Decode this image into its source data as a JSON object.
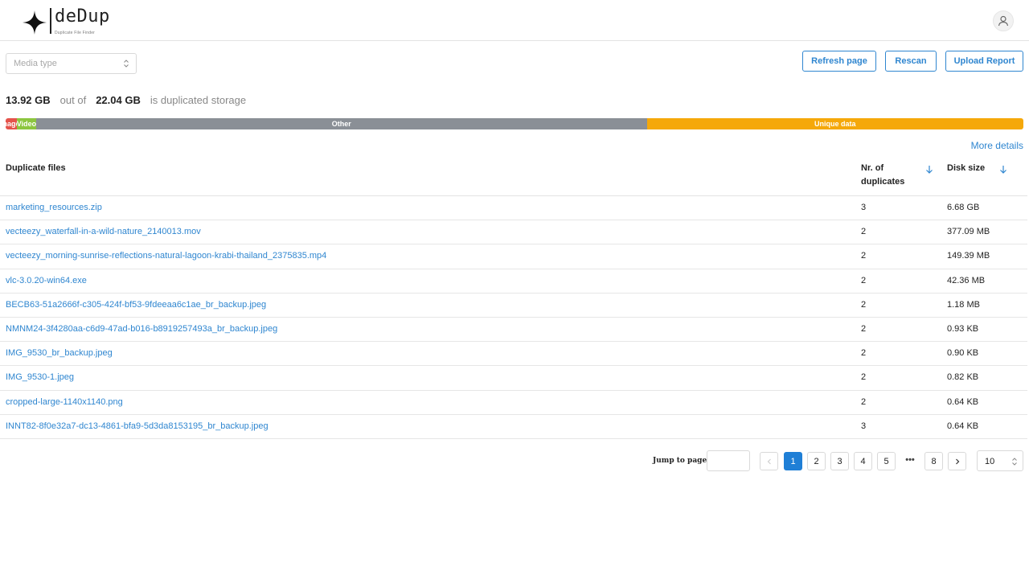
{
  "app": {
    "title": "deDup",
    "subtitle": "Duplicate File Finder"
  },
  "filters": {
    "media_type_placeholder": "Media type"
  },
  "toolbar": {
    "refresh_label": "Refresh page",
    "rescan_label": "Rescan",
    "upload_label": "Upload Report"
  },
  "storage": {
    "duplicated": "13.92 GB",
    "out_of_text": "out of",
    "total": "22.04 GB",
    "suffix_text": "is duplicated storage"
  },
  "storage_bar": {
    "segments": [
      {
        "label": "Images",
        "share": 0.011,
        "color": "#e5534b"
      },
      {
        "label": "Video",
        "share": 0.019,
        "color": "#8cc63f"
      },
      {
        "label": "Other",
        "share": 0.6,
        "color": "#8a8f96"
      },
      {
        "label": "Unique data",
        "share": 0.37,
        "color": "#f5a80a"
      }
    ]
  },
  "more_details_label": "More details",
  "table": {
    "columns": {
      "name": "Duplicate files",
      "duplicates": "Nr. of duplicates",
      "size": "Disk size"
    },
    "rows": [
      {
        "name": "marketing_resources.zip",
        "duplicates": "3",
        "size": "6.68 GB"
      },
      {
        "name": "vecteezy_waterfall-in-a-wild-nature_2140013.mov",
        "duplicates": "2",
        "size": "377.09 MB"
      },
      {
        "name": "vecteezy_morning-sunrise-reflections-natural-lagoon-krabi-thailand_2375835.mp4",
        "duplicates": "2",
        "size": "149.39 MB"
      },
      {
        "name": "vlc-3.0.20-win64.exe",
        "duplicates": "2",
        "size": "42.36 MB"
      },
      {
        "name": "BECB63-51a2666f-c305-424f-bf53-9fdeeaa6c1ae_br_backup.jpeg",
        "duplicates": "2",
        "size": "1.18 MB"
      },
      {
        "name": "NMNM24-3f4280aa-c6d9-47ad-b016-b8919257493a_br_backup.jpeg",
        "duplicates": "2",
        "size": "0.93 KB"
      },
      {
        "name": "IMG_9530_br_backup.jpeg",
        "duplicates": "2",
        "size": "0.90 KB"
      },
      {
        "name": "IMG_9530-1.jpeg",
        "duplicates": "2",
        "size": "0.82 KB"
      },
      {
        "name": "cropped-large-1140x1140.png",
        "duplicates": "2",
        "size": "0.64 KB"
      },
      {
        "name": "INNT82-8f0e32a7-dc13-4861-bfa9-5d3da8153195_br_backup.jpeg",
        "duplicates": "3",
        "size": "0.64 KB"
      }
    ]
  },
  "pagination": {
    "jump_label": "Jump to page",
    "prev_icon": "chevron-left-icon",
    "next_icon": "chevron-right-icon",
    "pages": [
      "1",
      "2",
      "3",
      "4",
      "5",
      "8"
    ],
    "current_page": "1",
    "ellipsis": "•••",
    "page_size": "10"
  },
  "colors": {
    "accent": "#2f86d0",
    "active_page": "#1f7fd6"
  }
}
